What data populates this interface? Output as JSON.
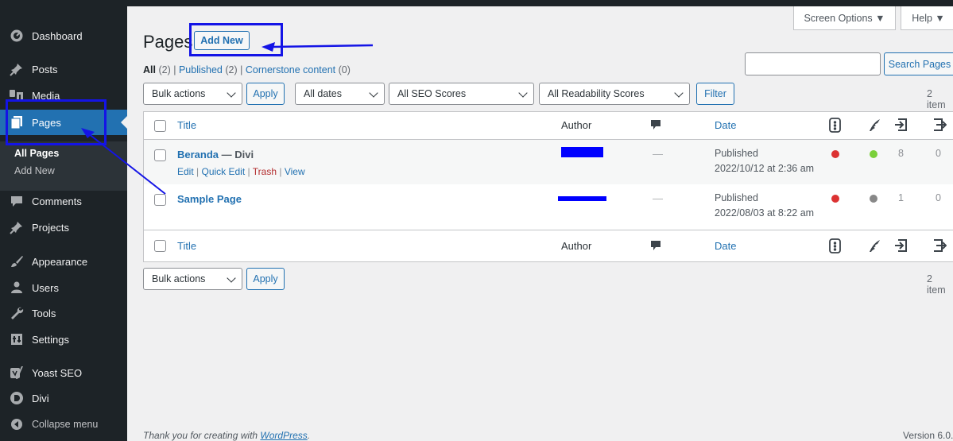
{
  "sidebar": {
    "items": [
      {
        "label": "Dashboard",
        "icon": "dashboard-icon"
      },
      {
        "label": "Posts",
        "icon": "pin-icon"
      },
      {
        "label": "Media",
        "icon": "media-icon"
      },
      {
        "label": "Pages",
        "icon": "pages-icon"
      },
      {
        "label": "Comments",
        "icon": "comment-icon"
      },
      {
        "label": "Projects",
        "icon": "pin-icon"
      },
      {
        "label": "Appearance",
        "icon": "brush-icon"
      },
      {
        "label": "Users",
        "icon": "users-icon"
      },
      {
        "label": "Tools",
        "icon": "wrench-icon"
      },
      {
        "label": "Settings",
        "icon": "settings-icon"
      },
      {
        "label": "Yoast SEO",
        "icon": "yoast-icon"
      },
      {
        "label": "Divi",
        "icon": "divi-icon"
      },
      {
        "label": "Collapse menu",
        "icon": "collapse-icon"
      }
    ],
    "submenu": [
      "All Pages",
      "Add New"
    ]
  },
  "screen_meta": {
    "screen_options": "Screen Options ▼",
    "help": "Help ▼"
  },
  "header": {
    "title": "Pages",
    "add_new": "Add New"
  },
  "filters": {
    "all": "All",
    "all_count": "(2)",
    "published": "Published",
    "published_count": "(2)",
    "cornerstone": "Cornerstone content",
    "cornerstone_count": "(0)",
    "sep": "|"
  },
  "search": {
    "placeholder": "",
    "button": "Search Pages"
  },
  "tablenav_top": {
    "bulk_actions": "Bulk actions",
    "apply": "Apply",
    "dates": "All dates",
    "seo": "All SEO Scores",
    "readability": "All Readability Scores",
    "filter": "Filter",
    "count": "2 item"
  },
  "table": {
    "columns": {
      "title": "Title",
      "author": "Author",
      "date": "Date"
    },
    "rows": [
      {
        "title": "Beranda",
        "state": "— Divi",
        "actions": {
          "edit": "Edit",
          "quick_edit": "Quick Edit",
          "trash": "Trash",
          "view": "View",
          "sep": "|"
        },
        "comments": "—",
        "status": "Published",
        "date": "2022/10/12 at 2:36 am",
        "seo_color": "#dc3232",
        "readability_color": "#7ad03a",
        "links_out": "8",
        "links_in": "0"
      },
      {
        "title": "Sample Page",
        "comments": "—",
        "status": "Published",
        "date": "2022/08/03 at 8:22 am",
        "seo_color": "#dc3232",
        "readability_color": "#888888",
        "links_out": "1",
        "links_in": "0"
      }
    ]
  },
  "tablenav_bottom": {
    "bulk_actions": "Bulk actions",
    "apply": "Apply",
    "count": "2 item"
  },
  "footer": {
    "thanks_prefix": "Thank you for creating with",
    "thanks_link": "WordPress",
    "thanks_suffix": ".",
    "version": "Version 6.0."
  },
  "colors": {
    "sidebar": "#1d2327",
    "accent": "#2271b1",
    "annotation": "#1414e6",
    "redaction": "#0000ff"
  }
}
